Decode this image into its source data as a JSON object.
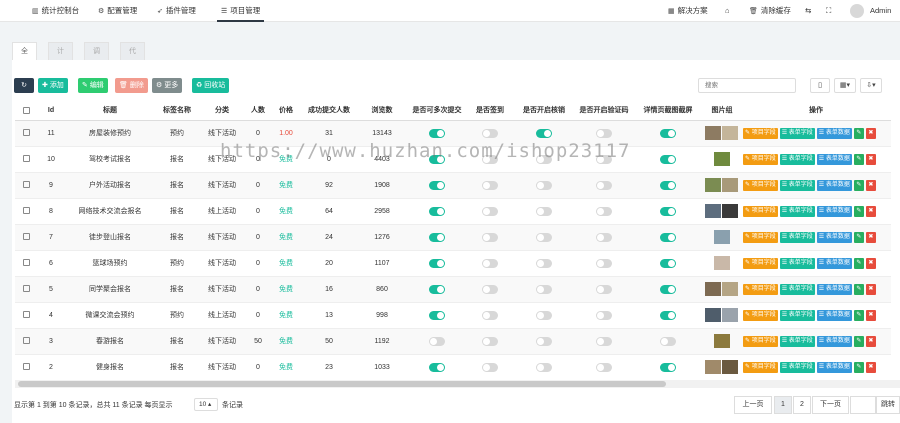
{
  "topnav": {
    "items": [
      "统计控制台",
      "配置管理",
      "插件管理",
      "项目管理"
    ],
    "right": [
      "解决方案",
      "清除缓存"
    ],
    "user": "Admin"
  },
  "tabs": [
    "全部",
    "计算",
    "调研",
    "代填写"
  ],
  "toolbar": {
    "add": "添加",
    "edit": "编辑",
    "delete": "删除",
    "more": "更多",
    "recycle": "回收站",
    "search_placeholder": "搜索"
  },
  "columns": [
    "Id",
    "标题",
    "标签名称",
    "分类",
    "人数",
    "价格",
    "成功提交人数",
    "浏览数",
    "是否可多次提交",
    "是否签到",
    "是否开启核销",
    "是否开启验证码",
    "详情页截图截屏",
    "图片组",
    "操作"
  ],
  "rows": [
    {
      "id": "11",
      "title": "房屋装修预约",
      "tag": "预约",
      "cat": "线下活动",
      "people": "0",
      "price": "1.00",
      "success": "31",
      "views": "13143",
      "multi": true,
      "sign": false,
      "verify": true,
      "captcha": false,
      "detail": true,
      "thumbs": [
        "#8d7b62",
        "#c4b59a"
      ]
    },
    {
      "id": "10",
      "title": "驾校考试报名",
      "tag": "报名",
      "cat": "线下活动",
      "people": "0",
      "price": "免费",
      "success": "0",
      "views": "4403",
      "multi": true,
      "sign": false,
      "verify": false,
      "captcha": false,
      "detail": true,
      "thumbs": [
        "#6f8a3e"
      ]
    },
    {
      "id": "9",
      "title": "户外活动报名",
      "tag": "报名",
      "cat": "线下活动",
      "people": "0",
      "price": "免费",
      "success": "92",
      "views": "1908",
      "multi": true,
      "sign": false,
      "verify": false,
      "captcha": false,
      "detail": true,
      "thumbs": [
        "#7b8c52",
        "#a89a7a"
      ]
    },
    {
      "id": "8",
      "title": "网络技术交流会报名",
      "tag": "报名",
      "cat": "线上活动",
      "people": "0",
      "price": "免费",
      "success": "64",
      "views": "2958",
      "multi": true,
      "sign": false,
      "verify": false,
      "captcha": false,
      "detail": true,
      "thumbs": [
        "#5d6d7e",
        "#3a3a3a"
      ]
    },
    {
      "id": "7",
      "title": "徒步登山报名",
      "tag": "报名",
      "cat": "线下活动",
      "people": "0",
      "price": "免费",
      "success": "24",
      "views": "1276",
      "multi": true,
      "sign": false,
      "verify": false,
      "captcha": false,
      "detail": true,
      "thumbs": [
        "#8aa0ae"
      ]
    },
    {
      "id": "6",
      "title": "篮球场预约",
      "tag": "预约",
      "cat": "线下活动",
      "people": "0",
      "price": "免费",
      "success": "20",
      "views": "1107",
      "multi": true,
      "sign": false,
      "verify": false,
      "captcha": false,
      "detail": true,
      "thumbs": [
        "#c9b8a8"
      ]
    },
    {
      "id": "5",
      "title": "同学聚会报名",
      "tag": "报名",
      "cat": "线下活动",
      "people": "0",
      "price": "免费",
      "success": "16",
      "views": "860",
      "multi": true,
      "sign": false,
      "verify": false,
      "captcha": false,
      "detail": true,
      "thumbs": [
        "#7d6a52",
        "#b5a585"
      ]
    },
    {
      "id": "4",
      "title": "微课交流会预约",
      "tag": "预约",
      "cat": "线上活动",
      "people": "0",
      "price": "免费",
      "success": "13",
      "views": "998",
      "multi": true,
      "sign": false,
      "verify": false,
      "captcha": false,
      "detail": true,
      "thumbs": [
        "#4f5d6b",
        "#9aa3ac"
      ]
    },
    {
      "id": "3",
      "title": "春游报名",
      "tag": "报名",
      "cat": "线下活动",
      "people": "50",
      "price": "免费",
      "success": "50",
      "views": "1192",
      "multi": false,
      "sign": false,
      "verify": false,
      "captcha": false,
      "detail": false,
      "thumbs": [
        "#8c7a3e"
      ]
    },
    {
      "id": "2",
      "title": "健身报名",
      "tag": "报名",
      "cat": "线下活动",
      "people": "0",
      "price": "免费",
      "success": "23",
      "views": "1033",
      "multi": true,
      "sign": false,
      "verify": false,
      "captcha": false,
      "detail": true,
      "thumbs": [
        "#a08a6a",
        "#6b5a40"
      ]
    }
  ],
  "ops": {
    "field": "项目字段",
    "form": "表单字段",
    "data": "表单数据"
  },
  "footer": {
    "summary": "显示第 1 到第 10 条记录，总共 11 条记录 每页显示",
    "page_size": "10 ▴",
    "after": "条记录",
    "prev": "上一页",
    "p1": "1",
    "p2": "2",
    "next": "下一页",
    "jump": "跳转"
  },
  "watermark": "https://www.huzhan.com/ishop23117"
}
